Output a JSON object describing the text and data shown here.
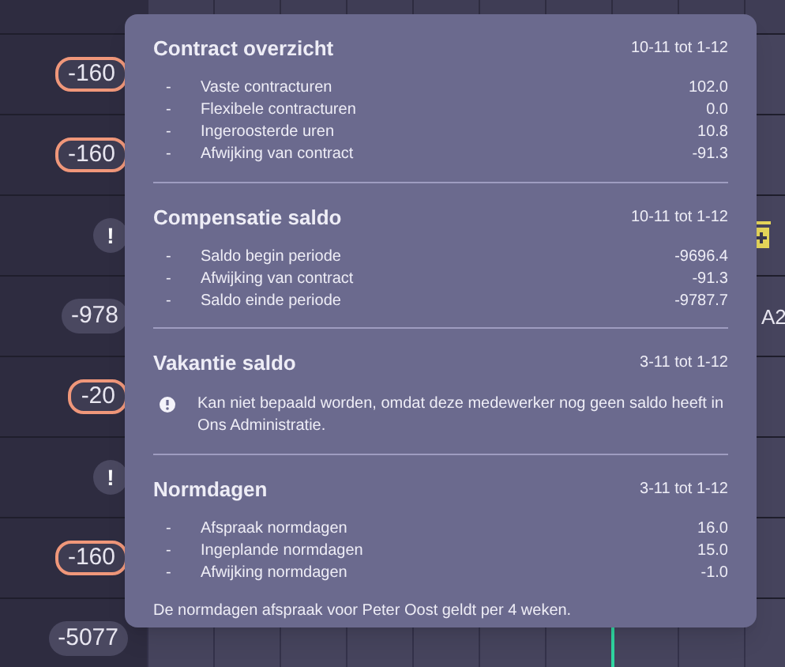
{
  "rows": [
    {
      "badge": "-160",
      "kind": "outlined"
    },
    {
      "badge": "-160",
      "kind": "outlined"
    },
    {
      "badge": "!",
      "kind": "alert",
      "marker": true
    },
    {
      "badge": "-978",
      "kind": "plain",
      "side_label": "A2"
    },
    {
      "badge": "-20",
      "kind": "outlined"
    },
    {
      "badge": "!",
      "kind": "alert"
    },
    {
      "badge": "-160",
      "kind": "outlined"
    },
    {
      "badge": "-5077",
      "kind": "plain"
    }
  ],
  "tooltip": {
    "sections": [
      {
        "title": "Contract overzicht",
        "period": "10-11 tot 1-12",
        "items": [
          {
            "bullet": "-",
            "label": "Vaste contracturen",
            "value": "102.0"
          },
          {
            "bullet": "-",
            "label": "Flexibele contracturen",
            "value": "0.0"
          },
          {
            "bullet": "-",
            "label": "Ingeroosterde uren",
            "value": "10.8"
          },
          {
            "bullet": "-",
            "label": "Afwijking van contract",
            "value": "-91.3"
          }
        ]
      },
      {
        "title": "Compensatie saldo",
        "period": "10-11 tot 1-12",
        "items": [
          {
            "bullet": "-",
            "label": "Saldo begin periode",
            "value": "-9696.4"
          },
          {
            "bullet": "-",
            "label": "Afwijking van contract",
            "value": "-91.3"
          },
          {
            "bullet": "-",
            "label": "Saldo einde periode",
            "value": "-9787.7"
          }
        ]
      },
      {
        "title": "Vakantie saldo",
        "period": "3-11 tot 1-12",
        "notice": "Kan niet bepaald worden, omdat deze medewerker nog geen saldo heeft in Ons Administratie."
      },
      {
        "title": "Normdagen",
        "period": "3-11 tot 1-12",
        "items": [
          {
            "bullet": "-",
            "label": "Afspraak normdagen",
            "value": "16.0"
          },
          {
            "bullet": "-",
            "label": "Ingeplande normdagen",
            "value": "15.0"
          },
          {
            "bullet": "-",
            "label": "Afwijking normdagen",
            "value": "-1.0"
          }
        ],
        "footnote": "De normdagen afspraak voor Peter Oost geldt per 4 weken."
      }
    ]
  }
}
